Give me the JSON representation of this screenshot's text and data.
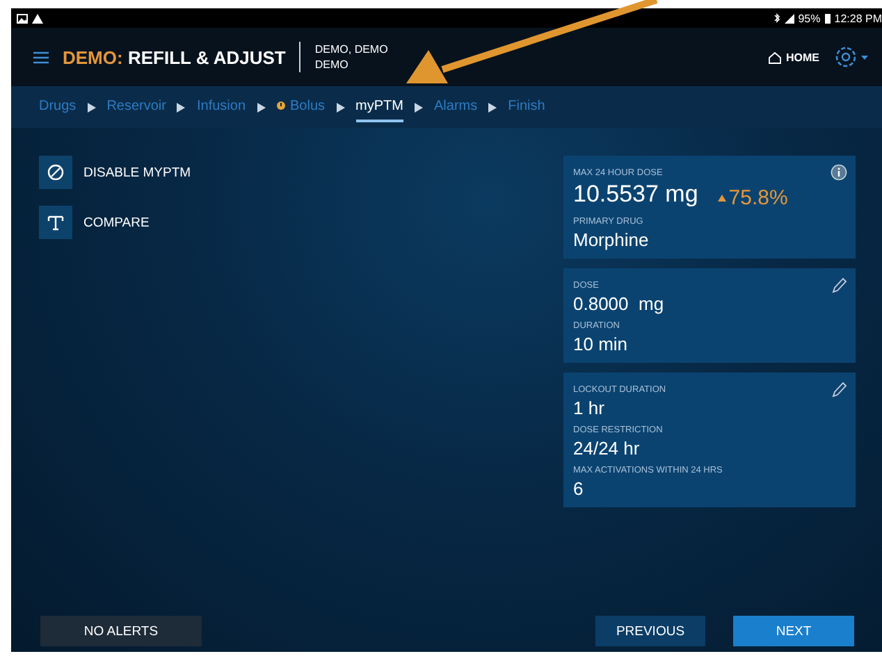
{
  "status_bar": {
    "battery": "95%",
    "time": "12:28 PM"
  },
  "header": {
    "prefix": "DEMO:",
    "title": "REFILL & ADJUST",
    "patient_line_1": "DEMO, DEMO",
    "patient_line_2": "DEMO",
    "home": "HOME"
  },
  "steps": [
    {
      "label": "Drugs",
      "selected": false,
      "warning": false
    },
    {
      "label": "Reservoir",
      "selected": false,
      "warning": false
    },
    {
      "label": "Infusion",
      "selected": false,
      "warning": false
    },
    {
      "label": "Bolus",
      "selected": false,
      "warning": true
    },
    {
      "label": "myPTM",
      "selected": true,
      "warning": false
    },
    {
      "label": "Alarms",
      "selected": false,
      "warning": false
    },
    {
      "label": "Finish",
      "selected": false,
      "warning": false
    }
  ],
  "actions": [
    {
      "kind": "disable",
      "label": "DISABLE MYPTM"
    },
    {
      "kind": "compare",
      "label": "COMPARE"
    }
  ],
  "cards": [
    {
      "kind": "info",
      "fields": [
        {
          "label": "MAX 24 HOUR DOSE",
          "value": "10.5537 mg",
          "kind": "large",
          "delta": "75.8%"
        },
        {
          "label": "PRIMARY DRUG",
          "value": "Morphine",
          "kind": "normal"
        }
      ]
    },
    {
      "kind": "edit",
      "fields": [
        {
          "label": "DOSE",
          "value": "0.8000  mg",
          "kind": "normal"
        },
        {
          "label": "DURATION",
          "value": "10 min",
          "kind": "normal"
        }
      ]
    },
    {
      "kind": "edit",
      "fields": [
        {
          "label": "LOCKOUT DURATION",
          "value": "1 hr",
          "kind": "normal"
        },
        {
          "label": "DOSE RESTRICTION",
          "value": "24/24 hr",
          "kind": "normal"
        },
        {
          "label": "MAX ACTIVATIONS WITHIN 24 HRS",
          "value": "6",
          "kind": "normal"
        }
      ]
    }
  ],
  "footer": {
    "alerts": "NO ALERTS",
    "previous": "PREVIOUS",
    "next": "NEXT"
  }
}
